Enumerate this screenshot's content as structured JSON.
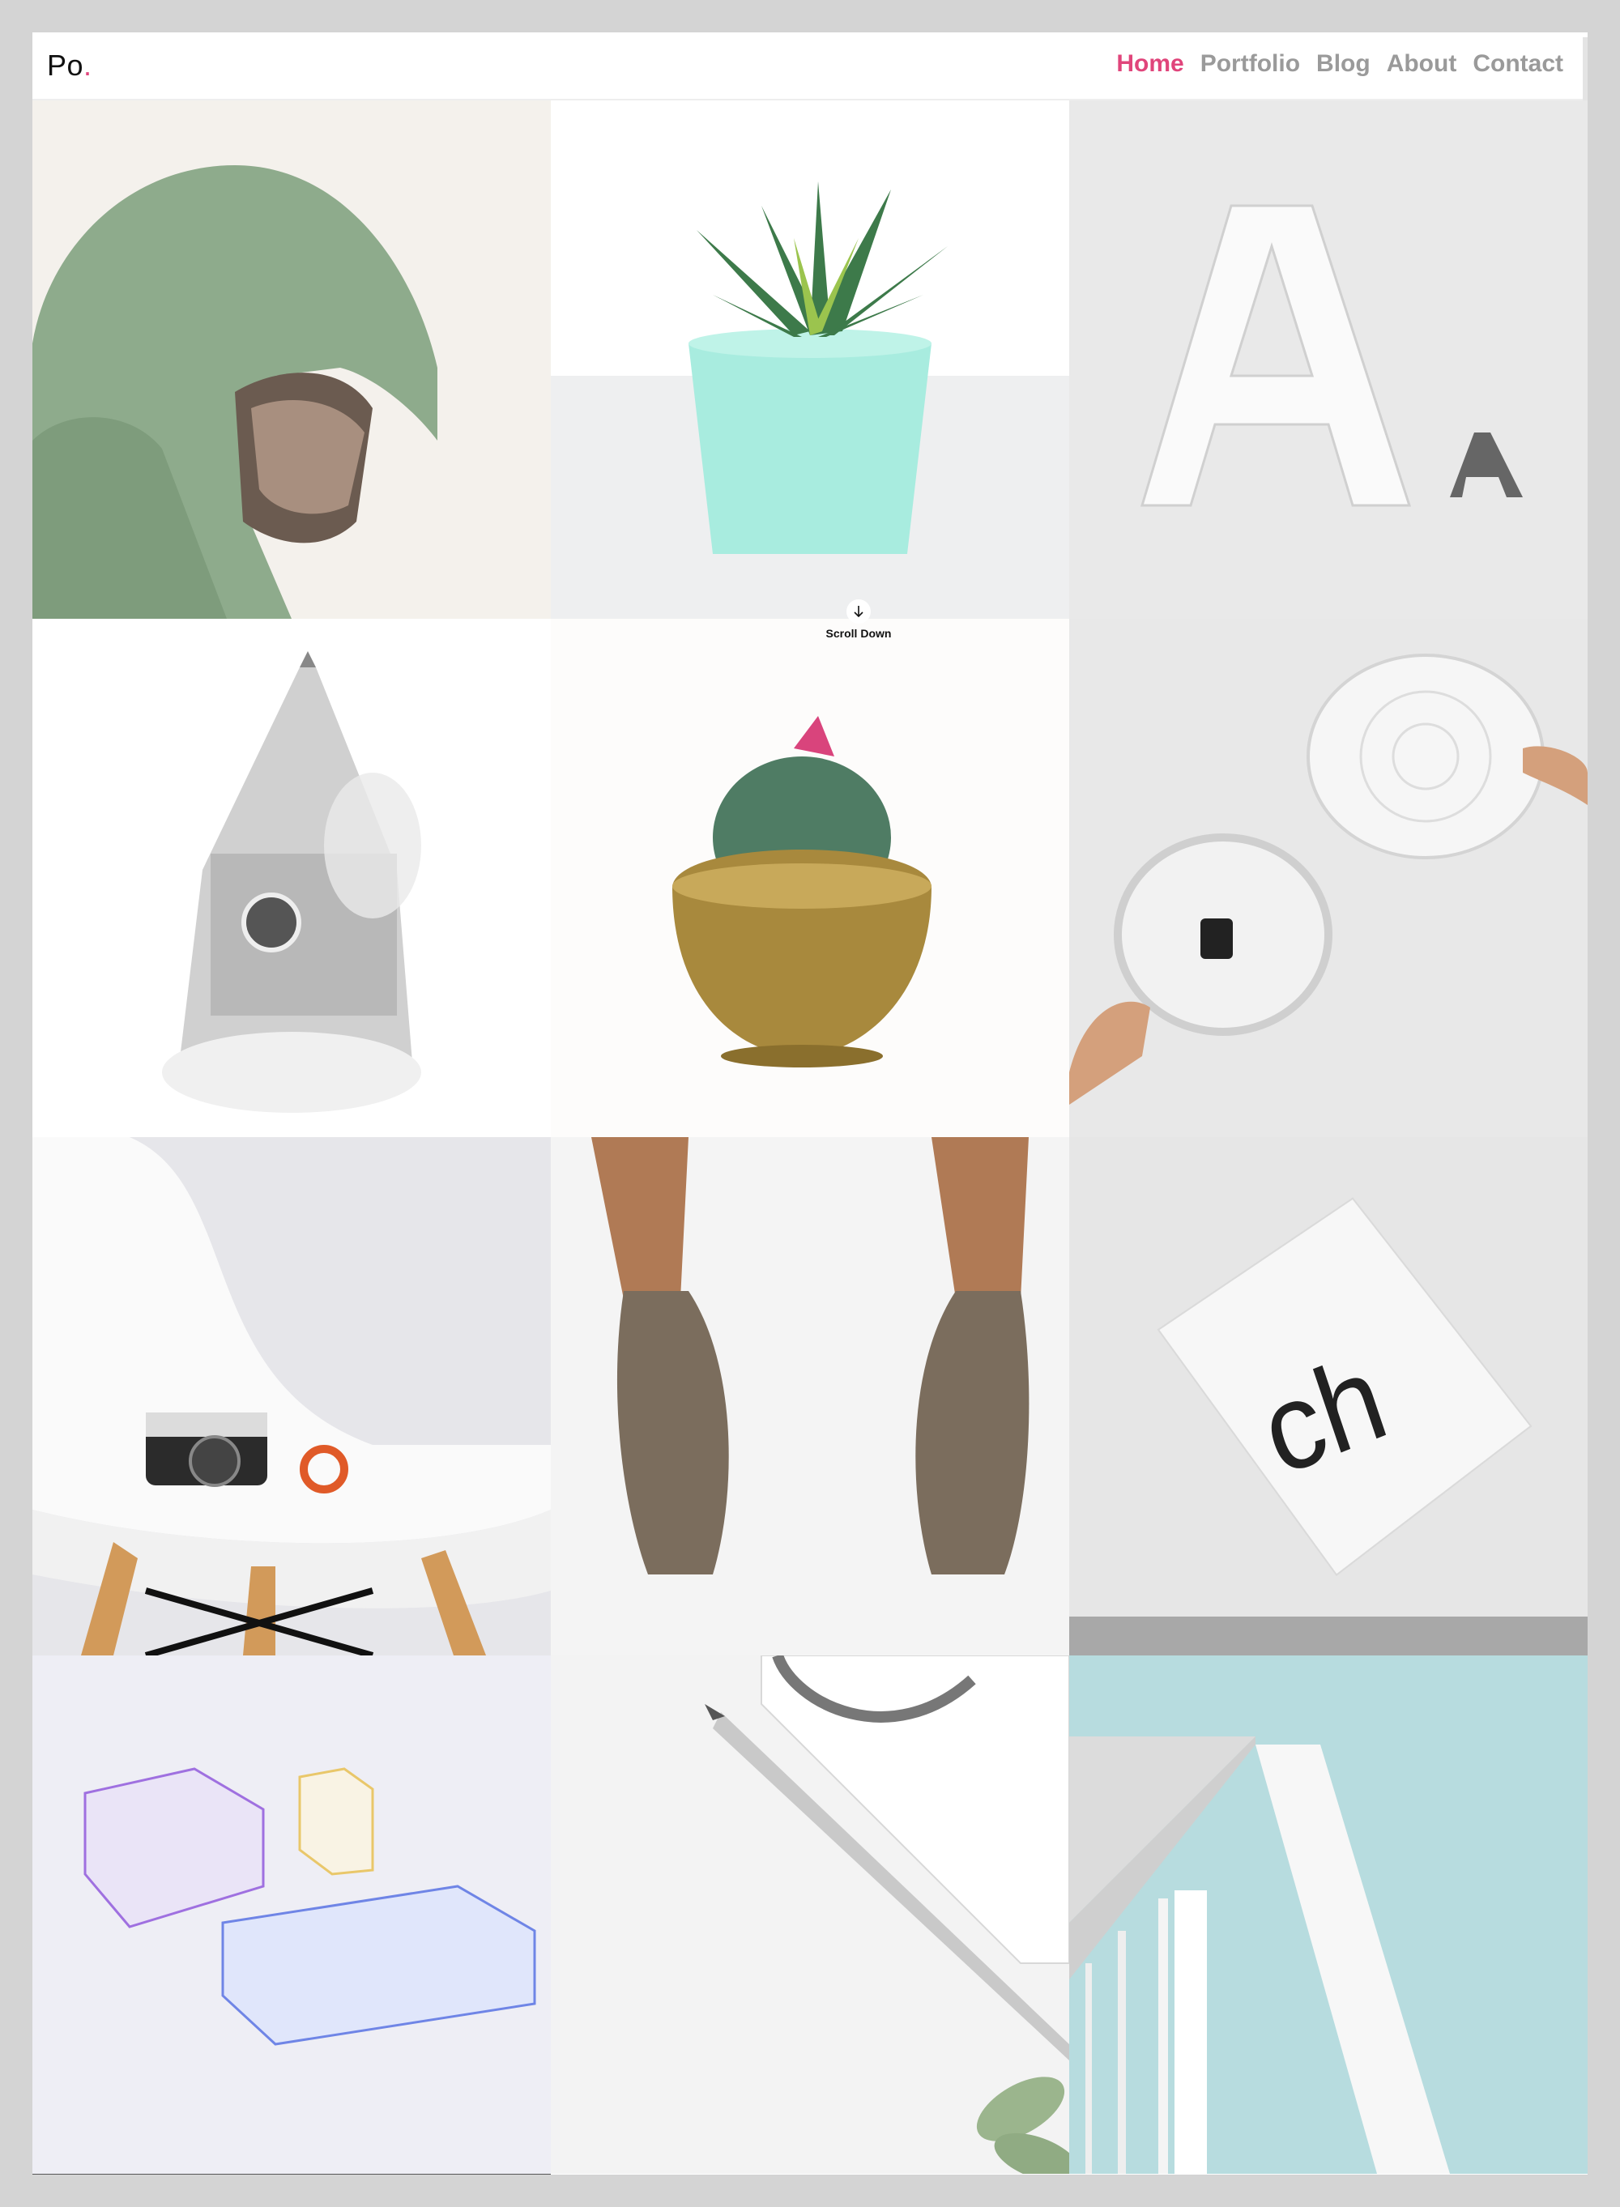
{
  "header": {
    "logo_text": "Po",
    "logo_dot": ".",
    "nav": [
      {
        "label": "Home",
        "active": true
      },
      {
        "label": "Portfolio",
        "active": false
      },
      {
        "label": "Blog",
        "active": false
      },
      {
        "label": "About",
        "active": false
      },
      {
        "label": "Contact",
        "active": false
      }
    ]
  },
  "scroll": {
    "label": "Scroll Down",
    "icon": "arrow-down-icon"
  },
  "tiles": [
    {
      "name": "portfolio-item-hooded-man"
    },
    {
      "name": "portfolio-item-succulent-pot"
    },
    {
      "name": "portfolio-item-letter-a"
    },
    {
      "name": "portfolio-item-clock-tower"
    },
    {
      "name": "portfolio-item-cactus-bowl"
    },
    {
      "name": "portfolio-item-wall-clock"
    },
    {
      "name": "portfolio-item-camera-chair"
    },
    {
      "name": "portfolio-item-bronze-hands"
    },
    {
      "name": "portfolio-item-ch-poster"
    },
    {
      "name": "portfolio-item-glass-boxes"
    },
    {
      "name": "portfolio-item-pencil-notebook"
    },
    {
      "name": "portfolio-item-building"
    }
  ],
  "tile_3_poster_text": "ch",
  "colors": {
    "accent": "#e0457b",
    "nav": "#9a9a9a",
    "background": "#d4d4d4"
  }
}
